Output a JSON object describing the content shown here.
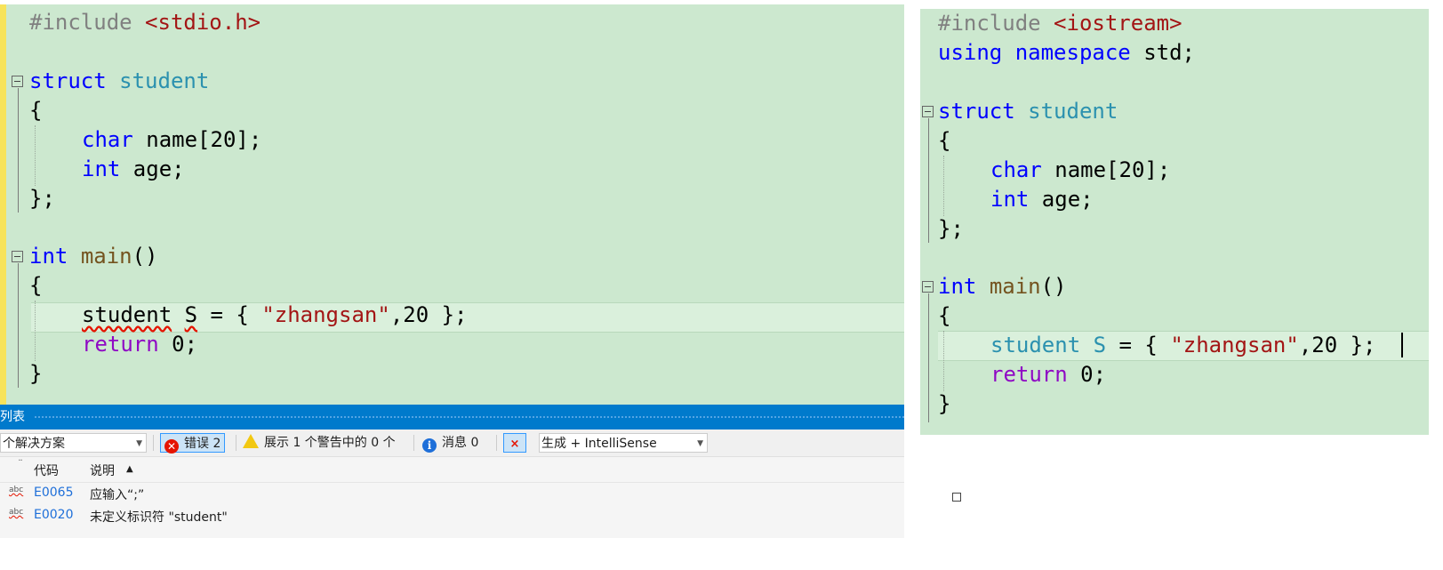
{
  "left_code": {
    "line1": {
      "pp": "#include ",
      "inc": "<stdio.h>"
    },
    "line3": {
      "kw": "struct",
      "type": "student"
    },
    "line4": "{",
    "line5": {
      "kw": "char",
      "rest": " name[20];"
    },
    "line6": {
      "kw": "int",
      "rest": " age;"
    },
    "line7": "};",
    "line9": {
      "kw": "int",
      "fn": "main",
      "rest": "()"
    },
    "line10": "{",
    "line11": {
      "ident": "student",
      "sp": " ",
      "var": "S",
      "mid": " = { ",
      "str": "\"zhangsan\"",
      "end": ",20 };"
    },
    "line12": {
      "kw": "return",
      "rest": " 0;"
    },
    "line13": "}"
  },
  "right_code": {
    "line1": {
      "pp": "#include ",
      "inc": "<iostream>"
    },
    "line2": {
      "kw1": "using",
      "kw2": "namespace",
      "rest": " std;"
    },
    "line4": {
      "kw": "struct",
      "type": "student"
    },
    "line5": "{",
    "line6": {
      "kw": "char",
      "rest": " name[20];"
    },
    "line7": {
      "kw": "int",
      "rest": " age;"
    },
    "line8": "};",
    "line10": {
      "kw": "int",
      "fn": "main",
      "rest": "()"
    },
    "line11": "{",
    "line12": {
      "type": "student",
      "var": " S",
      "mid": " = { ",
      "str": "\"zhangsan\"",
      "end": ",20 };"
    },
    "line13": {
      "kw": "return",
      "rest": " 0;"
    },
    "line14": "}"
  },
  "error_list": {
    "title": "列表",
    "scope_value": "个解决方案",
    "errors_label": "错误 2",
    "warnings_label": "展示 1 个警告中的 0 个",
    "messages_label": "消息 0",
    "build_value": "生成 + IntelliSense",
    "columns": {
      "code": "代码",
      "description": "说明"
    },
    "rows": [
      {
        "code": "E0065",
        "description": "应输入“;”"
      },
      {
        "code": "E0020",
        "description": "未定义标识符 \"student\""
      }
    ]
  },
  "icons": {
    "error": "error-circle-icon",
    "warning": "warning-triangle-icon",
    "info": "info-icon",
    "filter": "filter-icon",
    "abc": "abc-squiggle-icon"
  }
}
